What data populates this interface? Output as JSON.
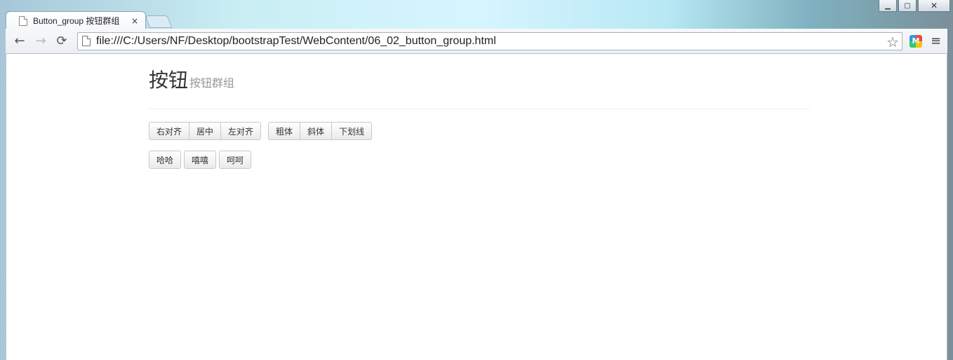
{
  "browser": {
    "tab": {
      "title": "Button_group 按钮群组",
      "close_label": "×"
    },
    "address": {
      "url": "file:///C:/Users/NF/Desktop/bootstrapTest/WebContent/06_02_button_group.html"
    },
    "controls": {
      "back": "←",
      "forward": "→",
      "reload": "⟳",
      "star": "☆",
      "menu": "≡",
      "minimize": "▁",
      "maximize": "▢",
      "close": "✕",
      "ext": "M"
    }
  },
  "page": {
    "title": "按钮",
    "subtitle": "按钮群组",
    "button_groups": [
      {
        "buttons": [
          "右对齐",
          "居中",
          "左对齐"
        ]
      },
      {
        "buttons": [
          "粗体",
          "斜体",
          "下划线"
        ]
      }
    ],
    "single_buttons": [
      "哈哈",
      "嘻嘻",
      "呵呵"
    ]
  }
}
